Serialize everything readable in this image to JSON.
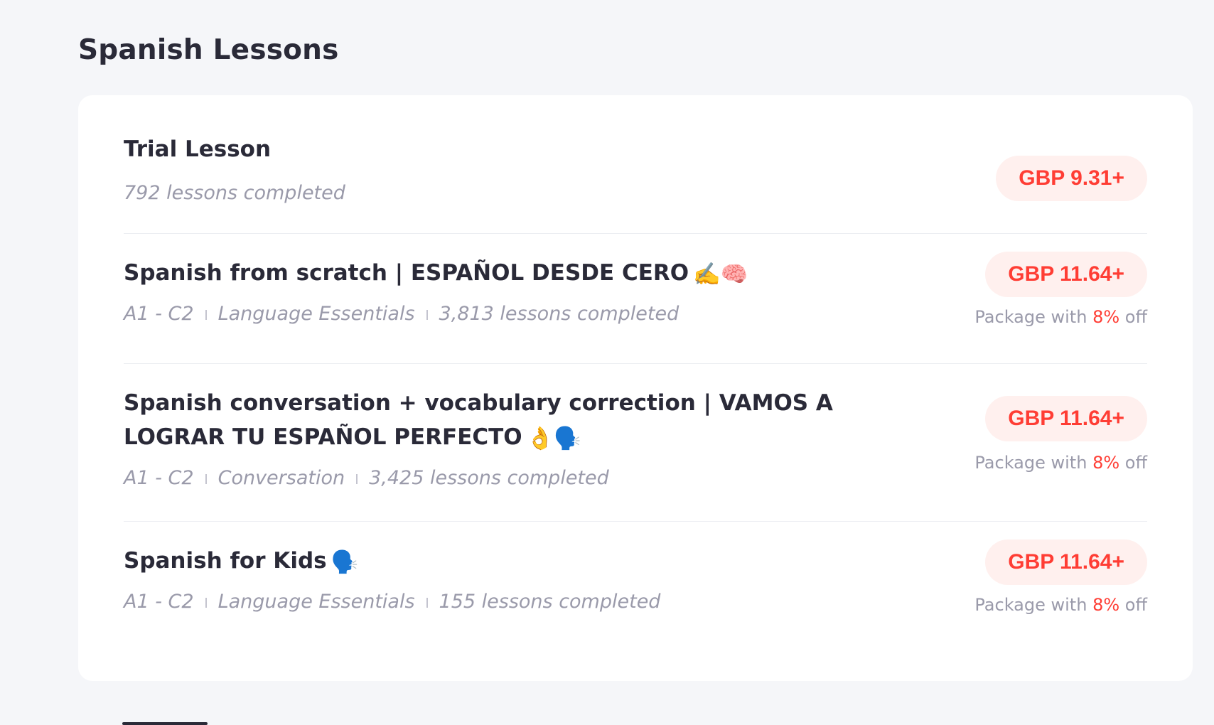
{
  "section": {
    "title": "Spanish Lessons"
  },
  "lessons": [
    {
      "title": "Trial Lesson",
      "emojis": "",
      "level": "",
      "category": "",
      "completed": "792 lessons completed",
      "price": "GBP 9.31+",
      "package": null
    },
    {
      "title": "Spanish from scratch | ESPAÑOL DESDE CERO",
      "emojis": "✍️🧠",
      "level": "A1 -  C2",
      "category": "Language Essentials",
      "completed": "3,813 lessons completed",
      "price": "GBP 11.64+",
      "package": {
        "prefix": "Package with",
        "percent": "8%",
        "suffix": "off"
      }
    },
    {
      "title": "Spanish conversation + vocabulary correction | VAMOS A LOGRAR TU ESPAÑOL PERFECTO",
      "emojis": "👌🗣️",
      "level": "A1 -  C2",
      "category": "Conversation",
      "completed": "3,425 lessons completed",
      "price": "GBP 11.64+",
      "package": {
        "prefix": "Package with",
        "percent": "8%",
        "suffix": "off"
      }
    },
    {
      "title": "Spanish for Kids",
      "emojis": "🗣️",
      "level": "A1 -  C2",
      "category": "Language Essentials",
      "completed": "155 lessons completed",
      "price": "GBP 11.64+",
      "package": {
        "prefix": "Package with",
        "percent": "8%",
        "suffix": "off"
      }
    }
  ]
}
